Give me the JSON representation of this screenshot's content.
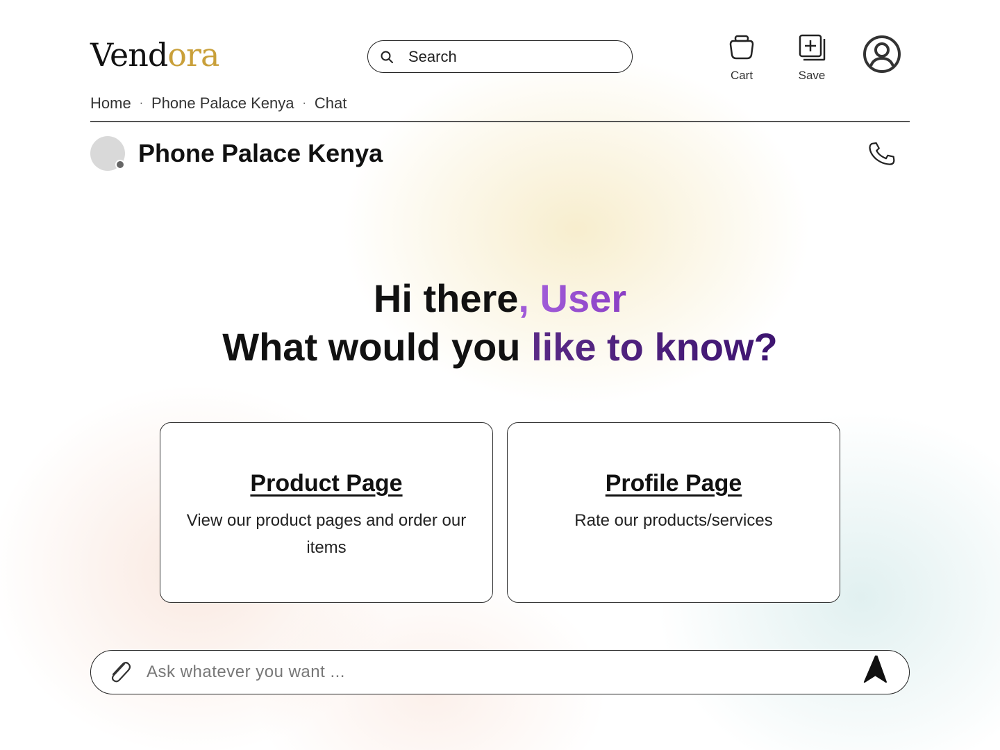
{
  "header": {
    "logo_prefix": "Vend",
    "logo_accent": "ora",
    "search_placeholder": "Search",
    "cart_label": "Cart",
    "save_label": "Save"
  },
  "breadcrumb": {
    "items": [
      "Home",
      "Phone Palace Kenya",
      "Chat"
    ],
    "separator": "·"
  },
  "store": {
    "name": "Phone Palace Kenya"
  },
  "greeting": {
    "hi_text": "Hi there",
    "comma": ",",
    "user_name": "User",
    "question_start": "What would you ",
    "question_accent": "like to know?"
  },
  "cards": [
    {
      "title": "Product Page",
      "description": "View our product pages and order our items"
    },
    {
      "title": "Profile Page",
      "description": "Rate our products/services"
    }
  ],
  "chat": {
    "placeholder": "Ask whatever you want ..."
  },
  "colors": {
    "brand_gold": "#c9a03a",
    "user_purple": "#a05bd8",
    "question_purple": "#4a1d7a"
  },
  "icons": [
    "search-icon",
    "cart-icon",
    "save-icon",
    "profile-icon",
    "phone-icon",
    "paperclip-icon",
    "send-icon"
  ]
}
